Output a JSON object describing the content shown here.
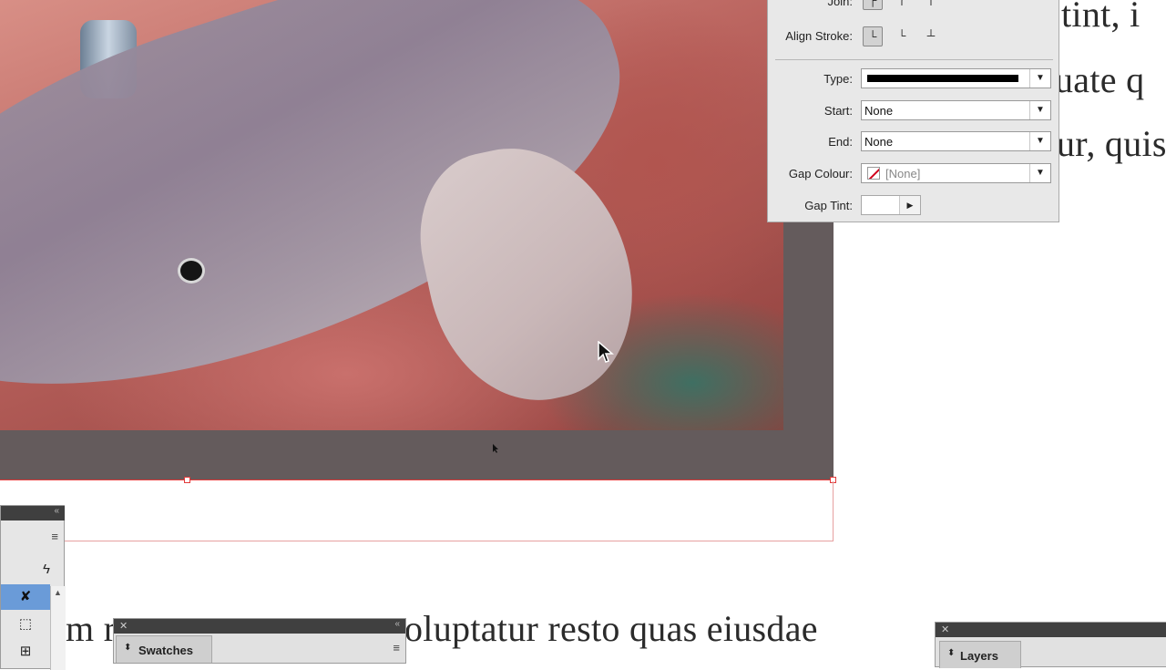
{
  "document_text": {
    "right_lines": [
      "tint, i",
      "uate q",
      "ur, quis"
    ],
    "bottom_line_left": "m r",
    "bottom_line_right": "oluptatur resto quas eiusdae"
  },
  "stroke_panel": {
    "join_label": "Join:",
    "align_stroke_label": "Align Stroke:",
    "type_label": "Type:",
    "start_label": "Start:",
    "start_value": "None",
    "end_label": "End:",
    "end_value": "None",
    "gap_colour_label": "Gap Colour:",
    "gap_colour_value": "[None]",
    "gap_tint_label": "Gap Tint:"
  },
  "swatches_panel": {
    "tab_label": "Swatches"
  },
  "layers_panel": {
    "tab_label": "Layers"
  },
  "colors": {
    "frame_fill": "#645b5c",
    "selection": "#e23a3a",
    "active_tool": "#6a9bd8"
  },
  "icons": {
    "join_buttons": [
      "miter-join-icon",
      "round-join-icon",
      "bevel-join-icon"
    ],
    "align_buttons": [
      "align-center-icon",
      "align-inside-icon",
      "align-outside-icon"
    ],
    "tools": [
      "lightning-icon",
      "pen-tool-icon",
      "rectangle-frame-icon",
      "text-frame-icon"
    ]
  }
}
